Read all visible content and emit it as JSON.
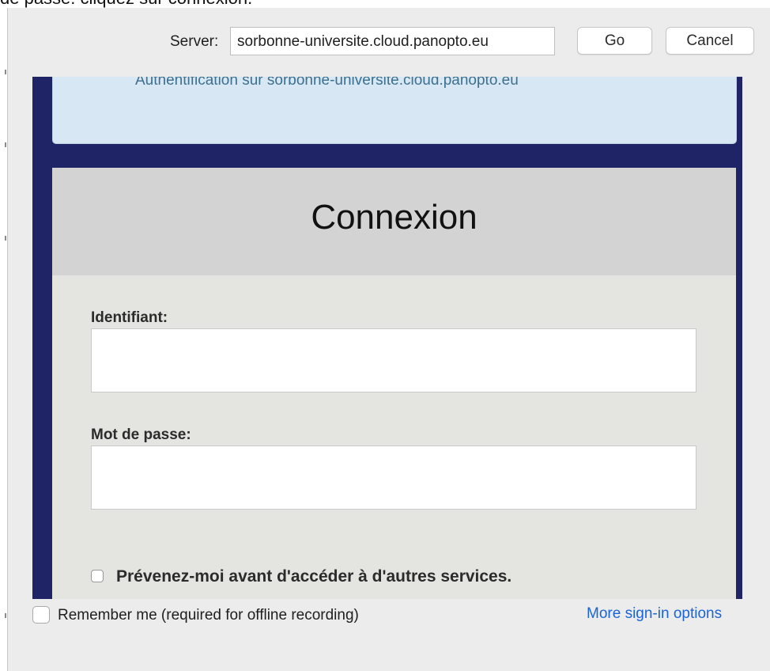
{
  "page": {
    "top_text": "de passe. cliquez sur connexion."
  },
  "dialog": {
    "server_label": "Server:",
    "server_value": "sorbonne-universite.cloud.panopto.eu",
    "go_label": "Go",
    "cancel_label": "Cancel",
    "remember_label": "Remember me (required for offline recording)",
    "remember_checked": false,
    "more_options_label": "More sign-in options"
  },
  "webview": {
    "info_text": "Authentification sur sorbonne-universite.cloud.panopto.eu",
    "title": "Connexion",
    "username_label": "Identifiant:",
    "username_value": "",
    "password_label": "Mot de passe:",
    "password_value": "",
    "warn_label": "Prévenez-moi avant d'accéder à d'autres services.",
    "warn_checked": false
  },
  "colors": {
    "webview_background": "#1f2466",
    "info_box": "#d7e8f4",
    "link": "#1a64d6"
  }
}
